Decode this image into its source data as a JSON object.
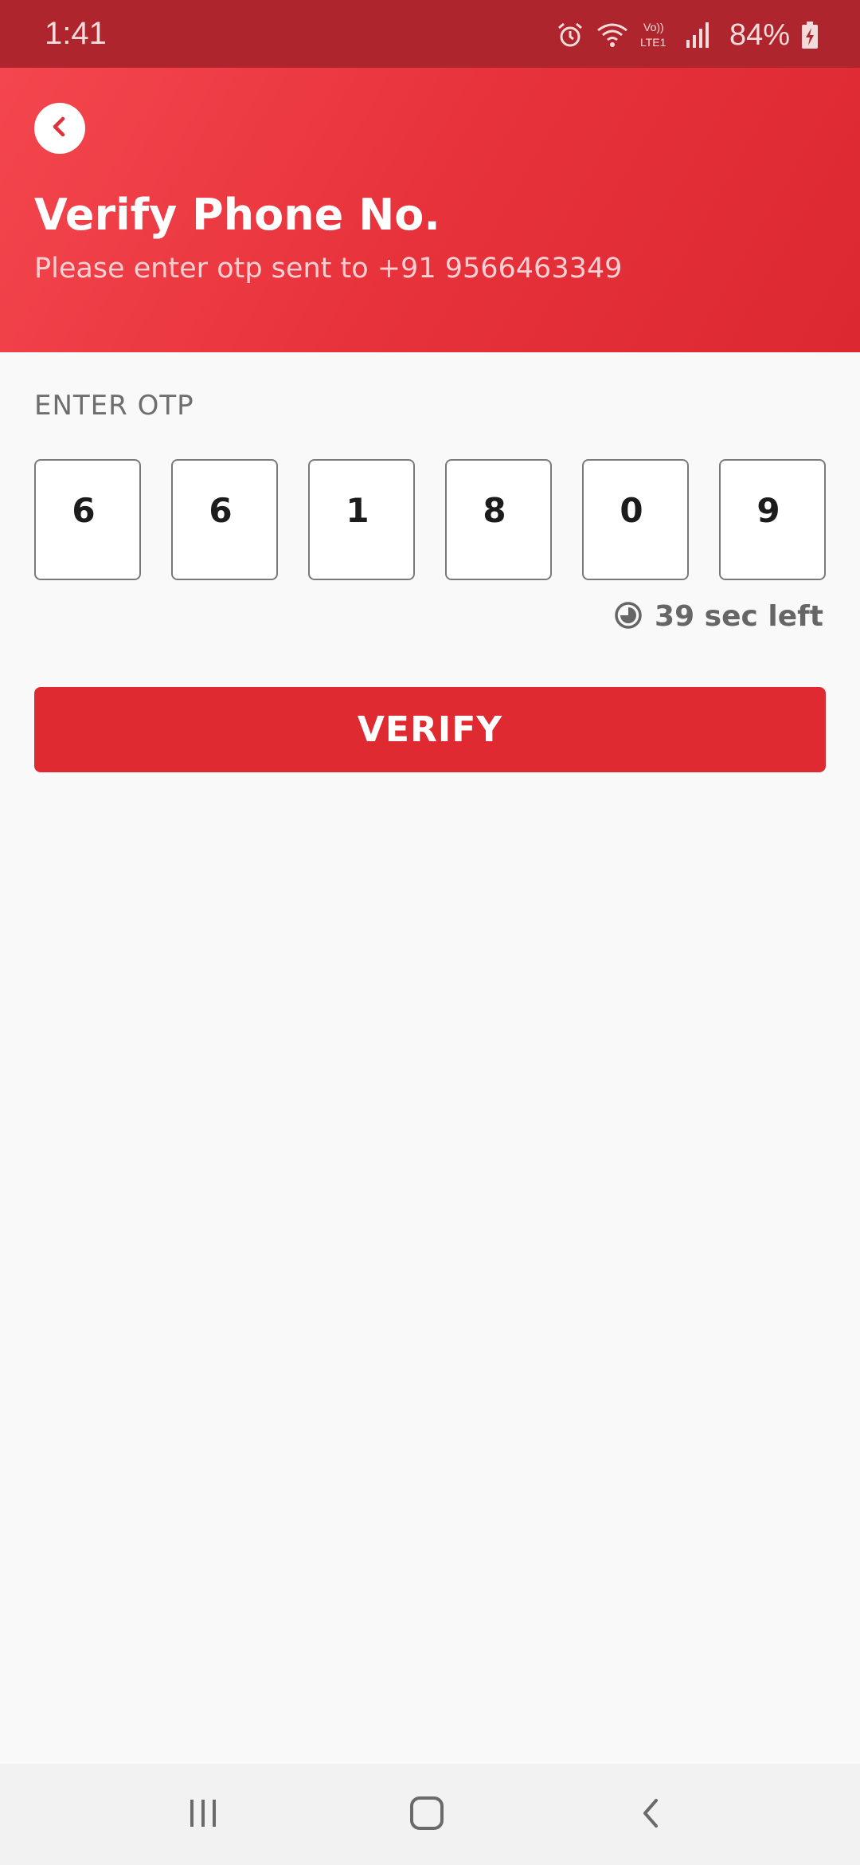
{
  "status_bar": {
    "time": "1:41",
    "battery": "84%",
    "icons": [
      "alarm-icon",
      "wifi-icon",
      "volte-icon",
      "signal-icon",
      "battery-charging-icon"
    ]
  },
  "header": {
    "title": "Verify Phone No.",
    "subtitle": "Please enter otp sent to +91 9566463349",
    "back_icon": "chevron-left-icon"
  },
  "otp": {
    "label": "ENTER OTP",
    "digits": [
      "6",
      "6",
      "1",
      "8",
      "0",
      "9"
    ],
    "timer_text": "39 sec left",
    "timer_icon": "timer-icon"
  },
  "verify_button": {
    "label": "VERIFY"
  },
  "nav_bar": {
    "items": [
      "recents-icon",
      "home-icon",
      "back-icon"
    ]
  },
  "colors": {
    "status_bar": "#af252d",
    "header_start": "#f4464e",
    "header_end": "#dc2830",
    "accent": "#e02a32",
    "background": "#f9f9f9"
  }
}
